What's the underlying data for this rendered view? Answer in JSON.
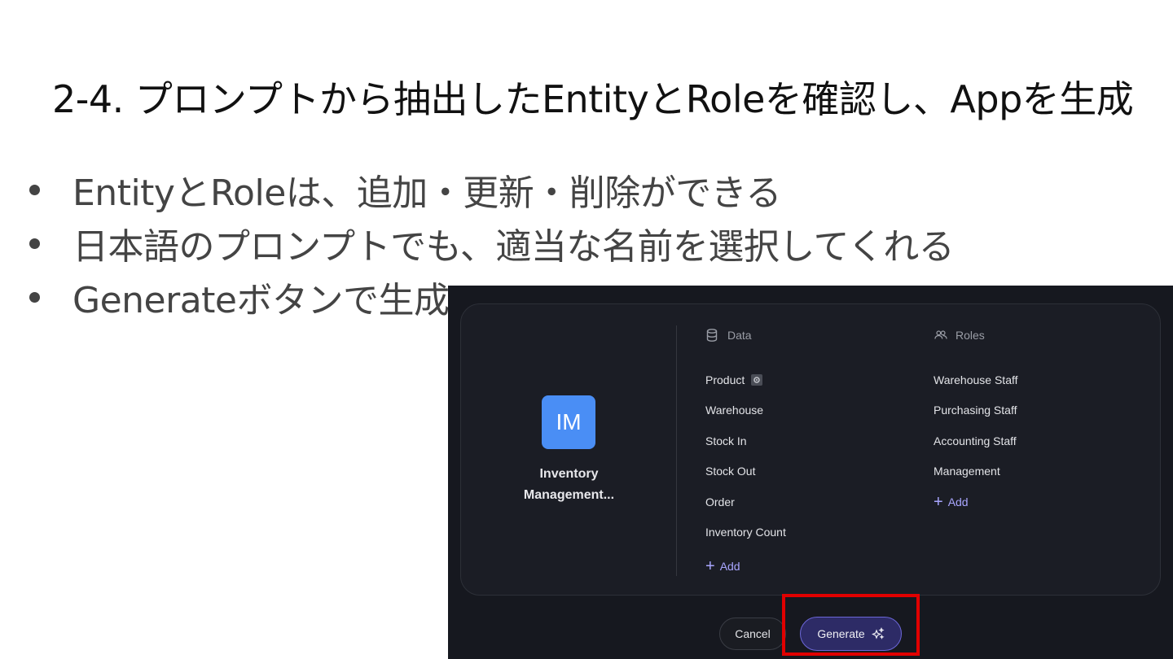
{
  "slide": {
    "title": "2-4. プロンプトから抽出したEntityとRoleを確認し、Appを生成",
    "bullets": [
      "EntityとRoleは、追加・更新・削除ができる",
      "日本語のプロンプトでも、適当な名前を選択してくれる",
      "Generateボタンで生成"
    ]
  },
  "app": {
    "initials": "IM",
    "name_line1": "Inventory",
    "name_line2": "Management...",
    "avatar_color": "#4a8ef5"
  },
  "data_column": {
    "header": "Data",
    "icon": "database-icon",
    "items": [
      "Product",
      "Warehouse",
      "Stock In",
      "Stock Out",
      "Order",
      "Inventory Count"
    ],
    "add_label": "Add"
  },
  "roles_column": {
    "header": "Roles",
    "icon": "users-icon",
    "items": [
      "Warehouse Staff",
      "Purchasing Staff",
      "Accounting Staff",
      "Management"
    ],
    "add_label": "Add"
  },
  "actions": {
    "cancel_label": "Cancel",
    "generate_label": "Generate",
    "generate_icon": "sparkle-icon"
  },
  "colors": {
    "highlight": "#e10000",
    "accent": "#a9a6ff",
    "generate_bg": "#2d2b66"
  }
}
